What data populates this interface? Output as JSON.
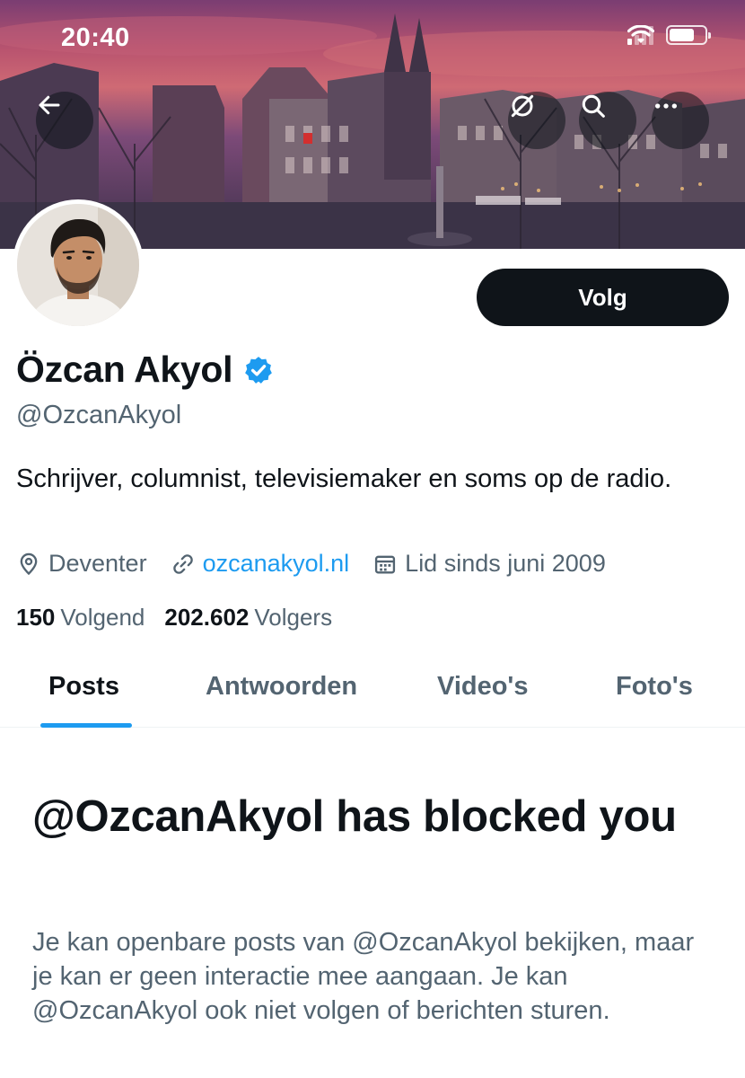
{
  "status_bar": {
    "time": "20:40"
  },
  "header": {
    "back_icon": "arrow-left-icon",
    "translate_icon": "grok-circle-slash-icon",
    "search_icon": "search-icon",
    "more_icon": "more-horizontal-icon"
  },
  "profile": {
    "display_name": "Özcan Akyol",
    "verified": true,
    "handle": "@OzcanAkyol",
    "bio": "Schrijver, columnist, televisiemaker en soms op de radio.",
    "location": "Deventer",
    "website": "ozcanakyol.nl",
    "joined": "Lid sinds juni 2009",
    "following_count": "150",
    "following_label": "Volgend",
    "followers_count": "202.602",
    "followers_label": "Volgers",
    "follow_button": "Volg"
  },
  "tabs": [
    {
      "label": "Posts",
      "active": true
    },
    {
      "label": "Antwoorden",
      "active": false
    },
    {
      "label": "Video's",
      "active": false
    },
    {
      "label": "Foto's",
      "active": false
    }
  ],
  "blocked": {
    "title": "@OzcanAkyol has blocked you",
    "description": "Je kan openbare posts van @OzcanAkyol bekijken, maar je kan er geen interactie mee aangaan. Je kan @OzcanAkyol ook niet volgen of berichten sturen."
  },
  "colors": {
    "accent": "#1d9bf0",
    "text_primary": "#0f1419",
    "text_secondary": "#536471"
  }
}
